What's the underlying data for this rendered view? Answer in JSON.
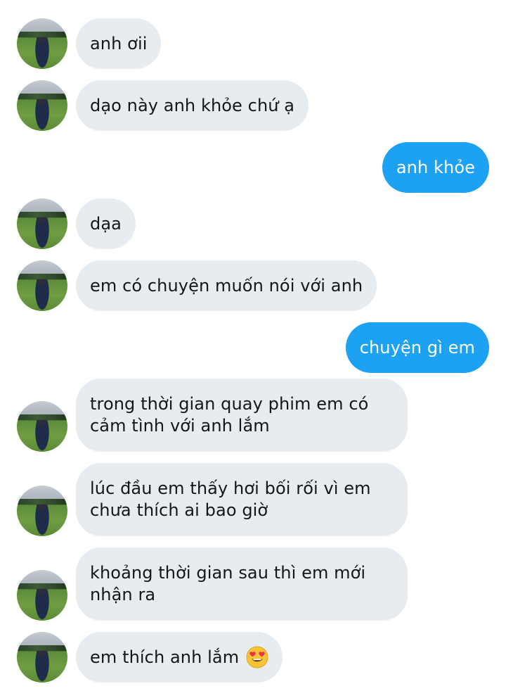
{
  "conversation": {
    "messages": [
      {
        "direction": "in",
        "text": "anh ơii"
      },
      {
        "direction": "in",
        "text": "dạo này anh khỏe chứ ạ"
      },
      {
        "direction": "out",
        "text": "anh khỏe"
      },
      {
        "direction": "in",
        "text": "dạa"
      },
      {
        "direction": "in",
        "text": "em có chuyện muốn nói với anh"
      },
      {
        "direction": "out",
        "text": "chuyện gì em"
      },
      {
        "direction": "in",
        "text": "trong thời gian quay phim em có\ncảm tình với anh lắm"
      },
      {
        "direction": "in",
        "text": "lúc đầu em thấy hơi bối rối vì em\nchưa thích ai bao giờ"
      },
      {
        "direction": "in",
        "text": "khoảng thời gian sau thì em mới\nnhận ra"
      },
      {
        "direction": "in",
        "text": "em thích anh lắm",
        "emoji": "heart-eyes-emoji"
      }
    ]
  },
  "colors": {
    "incoming_bubble": "#e6ecf0",
    "outgoing_bubble": "#1da1f2",
    "incoming_text": "#14171a",
    "outgoing_text": "#ffffff"
  }
}
